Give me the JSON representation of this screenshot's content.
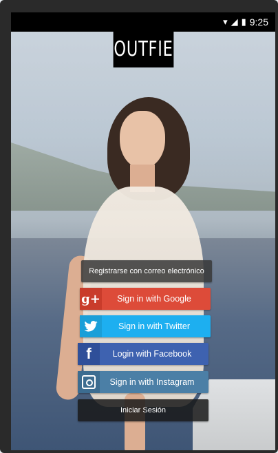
{
  "status": {
    "time": "9:25",
    "icons": [
      "wifi-icon",
      "signal-icon",
      "battery-icon"
    ]
  },
  "app": {
    "logo": "OUTFIE"
  },
  "actions": {
    "register_email": "Registrarse con correo electrónico",
    "google": "Sign in with Google",
    "twitter": "Sign in with Twitter",
    "facebook": "Login with Facebook",
    "instagram": "Sign in with Instagram",
    "login": "Iniciar Sesión"
  },
  "colors": {
    "google": "#dd4b39",
    "twitter": "#1daff0",
    "facebook": "#3e62b0",
    "instagram": "#4b7fa6"
  }
}
